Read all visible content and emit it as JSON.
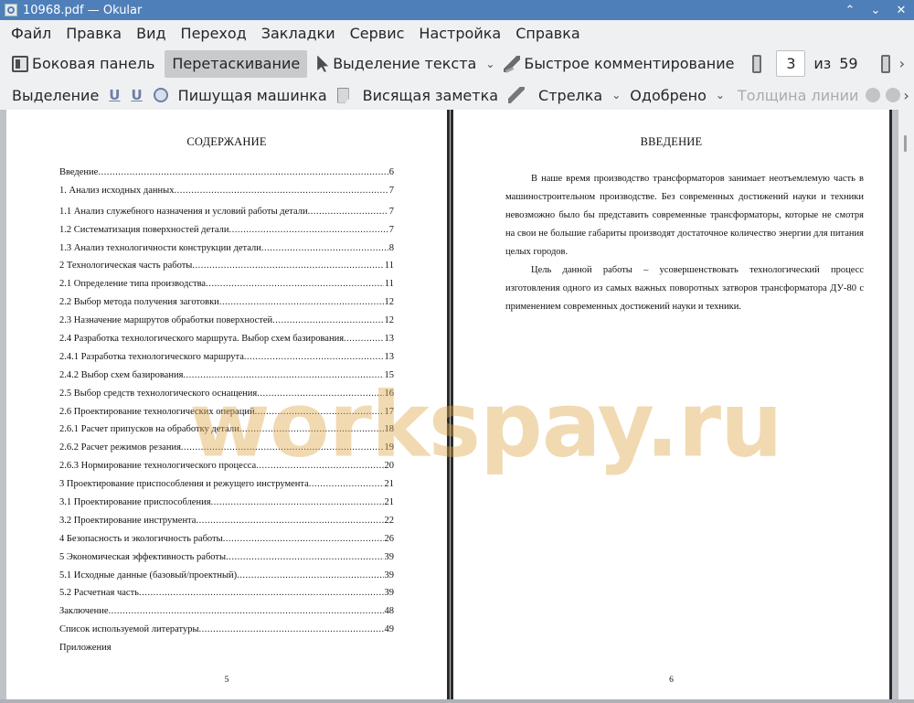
{
  "window": {
    "title": "10968.pdf  — Okular",
    "buttons": {
      "keep_above": "⌃",
      "minimize": "⌄",
      "close": "✕"
    }
  },
  "menu": [
    "Файл",
    "Правка",
    "Вид",
    "Переход",
    "Закладки",
    "Сервис",
    "Настройка",
    "Справка"
  ],
  "toolbar": {
    "sidebar": "Боковая панель",
    "browse": "Перетаскивание",
    "text_select": "Выделение текста",
    "quick_annotations": "Быстрое комментирование",
    "page_current": "3",
    "page_of": "из",
    "page_total": "59",
    "more": "›"
  },
  "annot_toolbar": {
    "highlight": "Выделение",
    "underline": "U",
    "squiggle": "U",
    "typewriter": "Пишущая машинка",
    "note": "Висящая заметка",
    "arrow": "Стрелка",
    "stamp": "Одобрено",
    "line_width": "Толщина линии",
    "more": "›"
  },
  "icons": [
    "sidebar-icon",
    "cursor-icon",
    "pen-icon",
    "page-up-icon",
    "page-down-icon",
    "underline-icon",
    "squiggle-icon",
    "stamp-icon",
    "note-icon",
    "brush-icon"
  ],
  "watermark": "workspay.ru",
  "left_page": {
    "heading": "СОДЕРЖАНИЕ",
    "toc": [
      {
        "title": "Введение",
        "page": "6"
      },
      {
        "title": "1. Анализ исходных данных",
        "page": "7"
      },
      {
        "title": "1.1 Анализ служебного назначения и условий работы детали",
        "page": "7"
      },
      {
        "title": "1.2 Систематизация поверхностей детали",
        "page": "7"
      },
      {
        "title": "1.3 Анализ технологичности конструкции детали",
        "page": "8"
      },
      {
        "title": "2 Технологическая часть работы",
        "page": "11"
      },
      {
        "title": "2.1 Определение типа производства",
        "page": "11"
      },
      {
        "title": "2.2 Выбор метода получения заготовки",
        "page": "12"
      },
      {
        "title": "2.3 Назначение маршрутов обработки поверхностей",
        "page": "12"
      },
      {
        "title": "2.4 Разработка технологического маршрута. Выбор схем базирования",
        "page": "13"
      },
      {
        "title": "2.4.1 Разработка технологического маршрута",
        "page": "13"
      },
      {
        "title": "2.4.2 Выбор схем базирования",
        "page": "15"
      },
      {
        "title": "2.5 Выбор средств технологического оснащения",
        "page": "16"
      },
      {
        "title": "2.6 Проектирование технологических операций",
        "page": "17"
      },
      {
        "title": "2.6.1 Расчет припусков на обработку детали",
        "page": "18"
      },
      {
        "title": "2.6.2 Расчет режимов резания",
        "page": "19"
      },
      {
        "title": "2.6.3 Нормирование технологического процесса",
        "page": "20"
      },
      {
        "title": "3 Проектирование приспособления и режущего инструмента",
        "page": "21"
      },
      {
        "title": "3.1 Проектирование приспособления",
        "page": "21"
      },
      {
        "title": "3.2 Проектирование инструмента",
        "page": "22"
      },
      {
        "title": "4 Безопасность и экологичность работы",
        "page": "26"
      },
      {
        "title": "5 Экономическая эффективность работы",
        "page": "39"
      },
      {
        "title": "5.1 Исходные данные (базовый/проектный)",
        "page": "39"
      },
      {
        "title": "5.2 Расчетная часть",
        "page": "39"
      },
      {
        "title": "Заключение",
        "page": "48"
      },
      {
        "title": "Список используемой литературы",
        "page": "49"
      },
      {
        "title": "Приложения",
        "page": ""
      }
    ],
    "page_number": "5"
  },
  "right_page": {
    "heading": "ВВЕДЕНИЕ",
    "paragraph1": "В наше время производство трансформаторов занимает неотъемлемую часть в машиностроительном производстве. Без современных достижений науки и техники невозможно было бы представить современные трансформаторы, которые не смотря на свои не большие габариты производят достаточное количество энергии для питания целых городов.",
    "paragraph2": "Цель данной работы – усовершенствовать технологический процесс изготовления одного из самых важных поворотных затворов трансформатора ДУ-80 с применением современных достижений науки и техники.",
    "page_number": "6"
  }
}
